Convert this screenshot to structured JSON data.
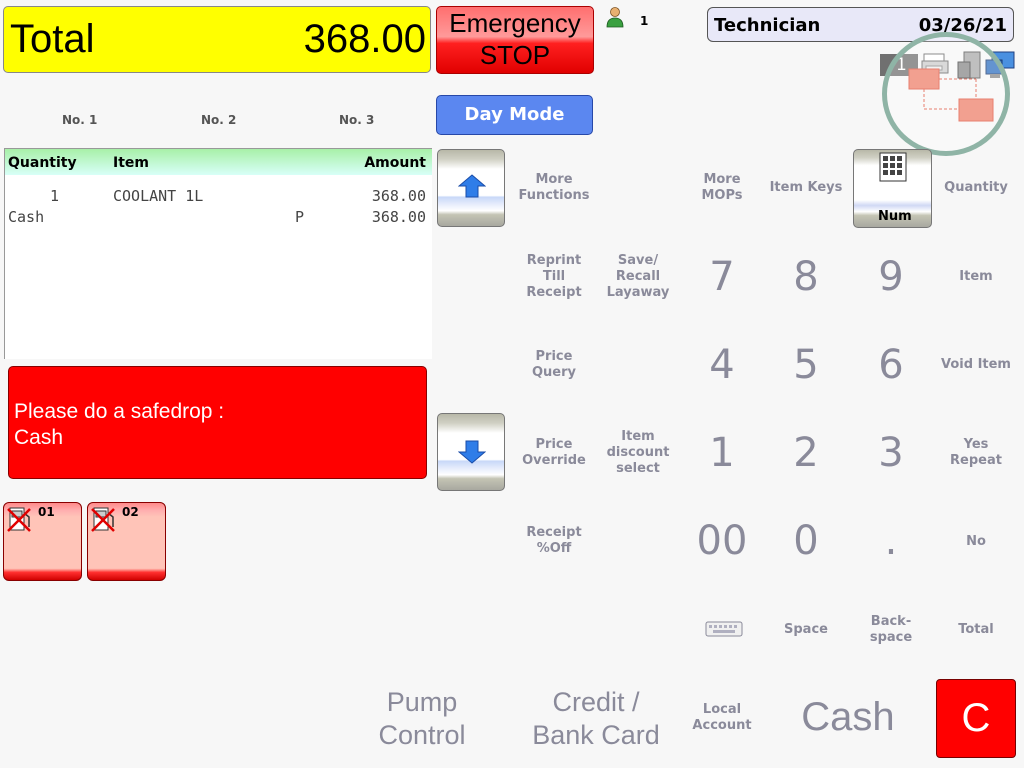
{
  "total": {
    "label": "Total",
    "value": "368.00"
  },
  "emergency": {
    "line1": "Emergency",
    "line2": "STOP"
  },
  "user": {
    "count": "1"
  },
  "operator": {
    "name": "Technician",
    "date": "03/26/21"
  },
  "status": {
    "register": "1"
  },
  "pumps_header": [
    "No. 1",
    "No. 2",
    "No. 3"
  ],
  "day_mode": "Day Mode",
  "receipt": {
    "columns": {
      "quantity": "Quantity",
      "item": "Item",
      "amount": "Amount"
    },
    "lines": [
      {
        "qty": "1",
        "item": "COOLANT 1L",
        "flag": "",
        "amount": "368.00"
      },
      {
        "qty": "Cash",
        "item": "",
        "flag": "P",
        "amount": "368.00"
      }
    ]
  },
  "alert": {
    "line1": "Please do a safedrop :",
    "line2": "Cash"
  },
  "pumps": [
    {
      "number": "01"
    },
    {
      "number": "02"
    }
  ],
  "functions": {
    "more_functions": [
      "More",
      "Functions"
    ],
    "reprint": [
      "Reprint",
      "Till",
      "Receipt"
    ],
    "save_recall": [
      "Save/",
      "Recall",
      "Layaway"
    ],
    "price_query": [
      "Price",
      "Query"
    ],
    "price_override": [
      "Price",
      "Override"
    ],
    "item_discount": [
      "Item",
      "discount",
      "select"
    ],
    "receipt_off": [
      "Receipt",
      "%Off"
    ],
    "more_mops": [
      "More",
      "MOPs"
    ],
    "item_keys": "Item Keys",
    "num": "Num",
    "quantity": "Quantity",
    "item": "Item",
    "void_item": "Void Item",
    "yes_repeat": [
      "Yes",
      "Repeat"
    ],
    "no": "No",
    "space": "Space",
    "backspace": [
      "Back-",
      "space"
    ],
    "total": "Total",
    "local_account": [
      "Local",
      "Account"
    ]
  },
  "keypad": {
    "k7": "7",
    "k8": "8",
    "k9": "9",
    "k4": "4",
    "k5": "5",
    "k6": "6",
    "k1": "1",
    "k2": "2",
    "k3": "3",
    "k00": "00",
    "k0": "0",
    "kdot": "."
  },
  "bottom": {
    "pump_control": [
      "Pump",
      "Control"
    ],
    "credit": [
      "Credit /",
      "Bank Card"
    ],
    "cash": "Cash",
    "clear": "C"
  },
  "colors": {
    "total_bg": "#ffff00",
    "alert_bg": "#ff0000",
    "day_mode_bg": "#5b87f0",
    "label_gray": "#8a8a9a"
  }
}
